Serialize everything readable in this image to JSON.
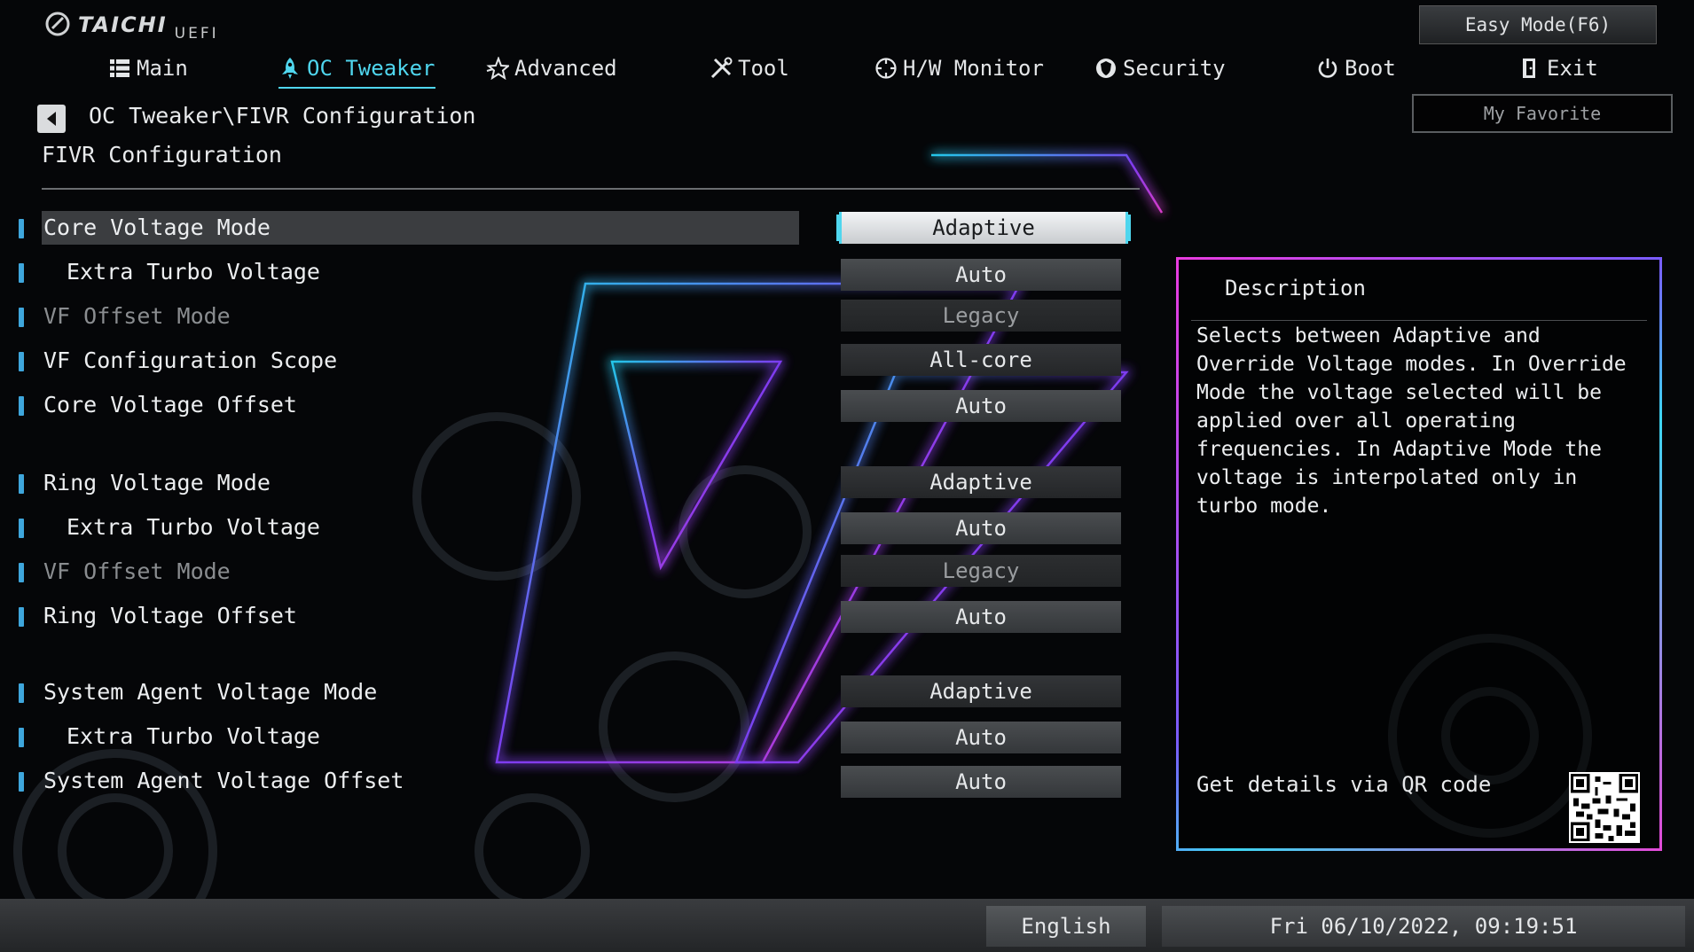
{
  "logo": {
    "brand": "TAICHI",
    "sub": "UEFI"
  },
  "nav": {
    "tabs": [
      {
        "label": "Main",
        "icon": "list-icon"
      },
      {
        "label": "OC Tweaker",
        "icon": "rocket-icon",
        "active": true
      },
      {
        "label": "Advanced",
        "icon": "star-icon"
      },
      {
        "label": "Tool",
        "icon": "tools-icon"
      },
      {
        "label": "H/W Monitor",
        "icon": "monitor-icon"
      },
      {
        "label": "Security",
        "icon": "shield-icon"
      },
      {
        "label": "Boot",
        "icon": "power-icon"
      },
      {
        "label": "Exit",
        "icon": "exit-door-icon"
      }
    ],
    "easy_mode": "Easy Mode(F6)",
    "my_favorite": "My Favorite"
  },
  "breadcrumb": "OC Tweaker\\FIVR Configuration",
  "section_title": "FIVR Configuration",
  "settings": [
    {
      "label": "Core Voltage Mode",
      "value": "Adaptive",
      "indent": false,
      "dim": false,
      "selected": true
    },
    {
      "label": "Extra Turbo Voltage",
      "value": "Auto",
      "indent": true,
      "dim": false
    },
    {
      "label": "VF Offset Mode",
      "value": "Legacy",
      "indent": false,
      "dim": true
    },
    {
      "label": "VF Configuration Scope",
      "value": "All-core",
      "indent": false,
      "dim": false
    },
    {
      "label": "Core Voltage Offset",
      "value": "Auto",
      "indent": false,
      "dim": false
    },
    {
      "label": "Ring Voltage Mode",
      "value": "Adaptive",
      "indent": false,
      "dim": false
    },
    {
      "label": "Extra Turbo Voltage",
      "value": "Auto",
      "indent": true,
      "dim": false
    },
    {
      "label": "VF Offset Mode",
      "value": "Legacy",
      "indent": false,
      "dim": true
    },
    {
      "label": "Ring Voltage Offset",
      "value": "Auto",
      "indent": false,
      "dim": false
    },
    {
      "label": "System Agent Voltage Mode",
      "value": "Adaptive",
      "indent": false,
      "dim": false
    },
    {
      "label": "Extra Turbo Voltage",
      "value": "Auto",
      "indent": true,
      "dim": false
    },
    {
      "label": "System Agent Voltage Offset",
      "value": "Auto",
      "indent": false,
      "dim": false
    }
  ],
  "description": {
    "title": "Description",
    "body": "Selects between Adaptive and Override Voltage modes. In Override Mode the voltage selected will be applied over all operating frequencies. In Adaptive Mode the voltage is interpolated only in turbo mode.",
    "qr_text": "Get details via QR code"
  },
  "footer": {
    "language": "English",
    "datetime": "Fri 06/10/2022, 09:19:51"
  },
  "colors": {
    "accent": "#4fd6ee",
    "row_marker": "#3ea6dc",
    "panel_border": "#ea3ce0"
  }
}
